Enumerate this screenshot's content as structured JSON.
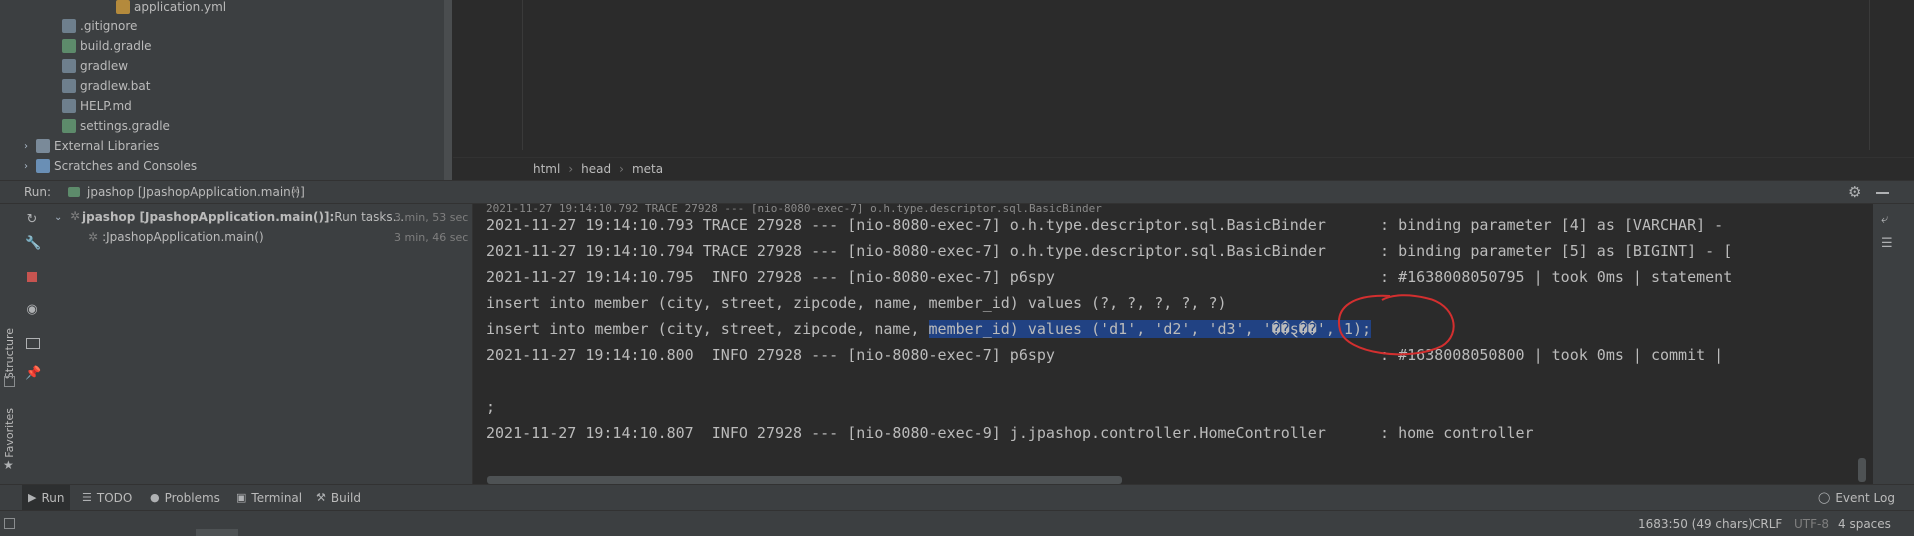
{
  "project_tree": {
    "items": [
      {
        "label": "application.yml",
        "icon": "yml-file-icon"
      },
      {
        "label": ".gitignore",
        "icon": "file-icon"
      },
      {
        "label": "build.gradle",
        "icon": "gradle-icon"
      },
      {
        "label": "gradlew",
        "icon": "file-icon"
      },
      {
        "label": "gradlew.bat",
        "icon": "file-icon"
      },
      {
        "label": "HELP.md",
        "icon": "file-icon"
      },
      {
        "label": "settings.gradle",
        "icon": "gradle-icon"
      },
      {
        "label": "External Libraries",
        "icon": "library-icon"
      },
      {
        "label": "Scratches and Consoles",
        "icon": "scratch-icon"
      }
    ]
  },
  "breadcrumbs": [
    "html",
    "head",
    "meta"
  ],
  "run_panel": {
    "label": "Run:",
    "tab_label": "jpashop [JpashopApplication.main()]",
    "close_glyph": "×",
    "tree": [
      {
        "label": "jpashop [JpashopApplication.main()]:",
        "suffix": " Run tasks...",
        "time": "3 min, 53 sec"
      },
      {
        "label": ":JpashopApplication.main()",
        "time": "3 min, 46 sec"
      }
    ]
  },
  "console": {
    "lines": [
      {
        "text": "2021-11-27 19:14:10.793 TRACE 27928 --- [nio-8080-exec-7] o.h.type.descriptor.sql.BasicBinder      : binding parameter [4] as [VARCHAR] - "
      },
      {
        "text": "2021-11-27 19:14:10.794 TRACE 27928 --- [nio-8080-exec-7] o.h.type.descriptor.sql.BasicBinder      : binding parameter [5] as [BIGINT] - ["
      },
      {
        "text": "2021-11-27 19:14:10.795  INFO 27928 --- [nio-8080-exec-7] p6spy                                    : #1638008050795 | took 0ms | statement"
      },
      {
        "text": "insert into member (city, street, zipcode, name, member_id) values (?, ?, ?, ?, ?)"
      },
      {
        "pre": "insert into member (city, street, zipcode, name, ",
        "selected": "member_id) values ('d1', 'd2', 'd3', '��ȿ��', 1);"
      },
      {
        "text": "2021-11-27 19:14:10.800  INFO 27928 --- [nio-8080-exec-7] p6spy                                    : #1638008050800 | took 0ms | commit |"
      },
      {
        "text": ""
      },
      {
        "text": ";"
      },
      {
        "text": "2021-11-27 19:14:10.807  INFO 27928 --- [nio-8080-exec-9] j.jpashop.controller.HomeController      : home controller"
      }
    ]
  },
  "side_labels": {
    "structure": "Structure",
    "favorites": "Favorites"
  },
  "bottom_tabs": [
    {
      "label": "Run",
      "icon": "play-icon"
    },
    {
      "label": "TODO",
      "icon": "list-icon"
    },
    {
      "label": "Problems",
      "icon": "info-icon"
    },
    {
      "label": "Terminal",
      "icon": "terminal-icon"
    },
    {
      "label": "Build",
      "icon": "hammer-icon"
    }
  ],
  "event_log": "Event Log",
  "status_bar": {
    "position": "1683:50 (49 chars)",
    "line_separator": "CRLF",
    "encoding": "UTF-8",
    "indent": "4 spaces"
  },
  "colors": {
    "selection": "#214283",
    "annotation": "#d32f2f"
  }
}
